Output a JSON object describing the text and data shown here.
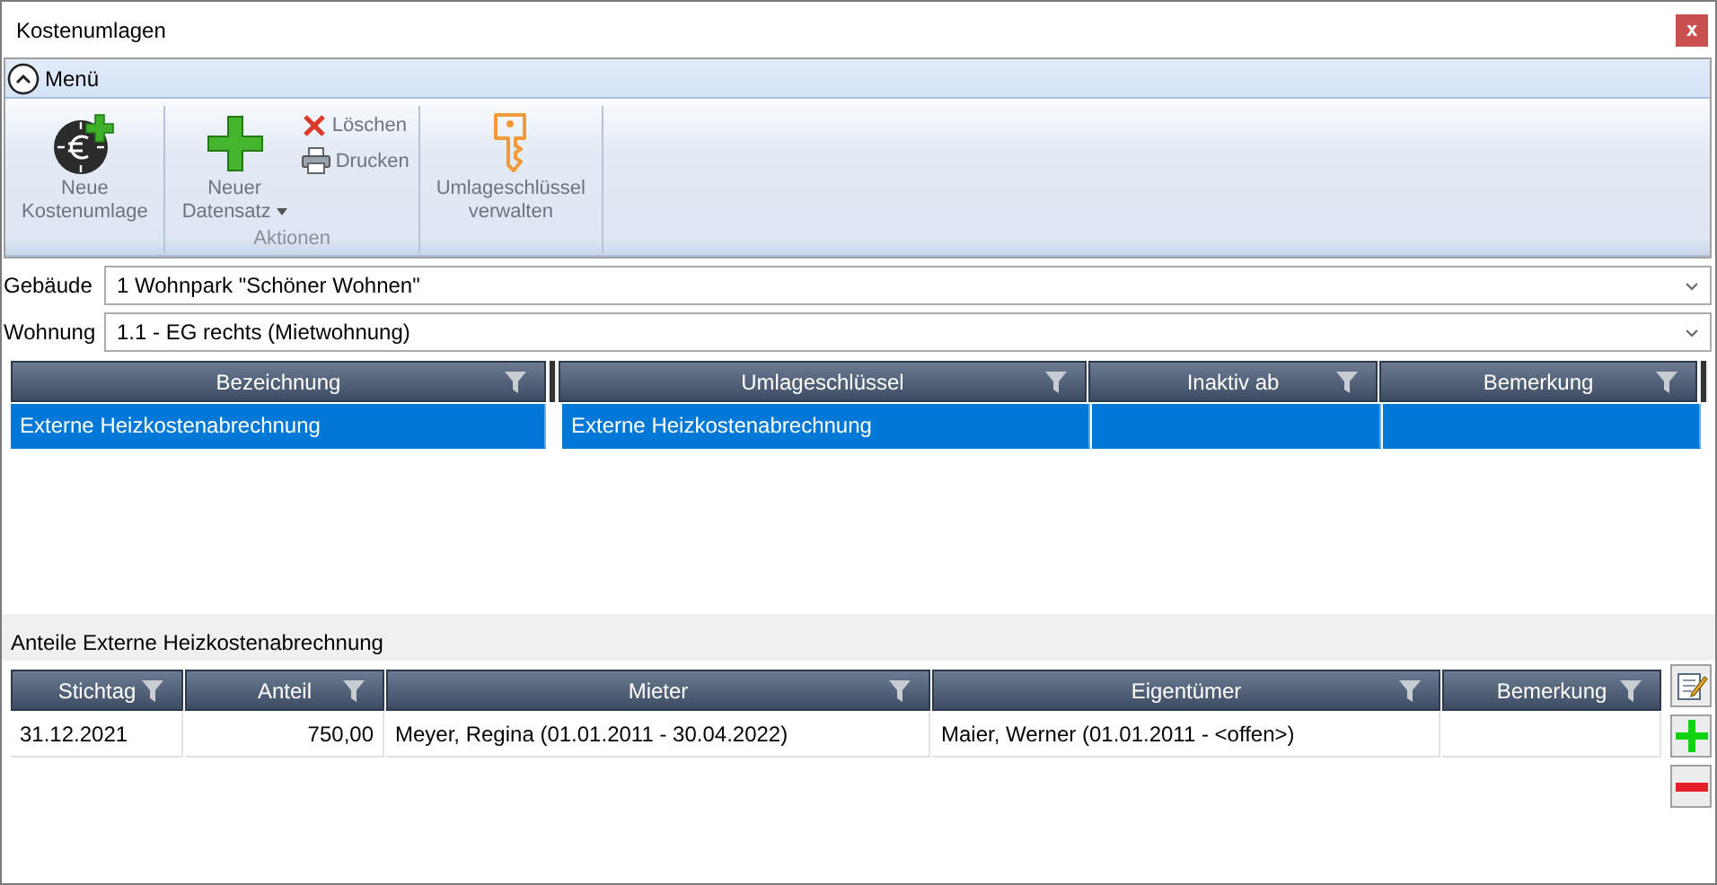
{
  "window": {
    "title": "Kostenumlagen",
    "close": "x"
  },
  "ribbon": {
    "toggle": "Menü",
    "expanded": true,
    "groups": [
      {
        "items": [
          {
            "kind": "large",
            "text": "Neue\nKostenumlage"
          }
        ]
      },
      {
        "label": "Aktionen",
        "items": [
          {
            "kind": "large",
            "text": "Neuer\nDatensatz",
            "dropdown": true
          },
          {
            "kind": "small",
            "text": "Löschen"
          },
          {
            "kind": "small",
            "text": "Drucken"
          }
        ]
      },
      {
        "items": [
          {
            "kind": "large",
            "text": "Umlageschlüssel\nverwalten"
          }
        ]
      }
    ]
  },
  "fields": [
    {
      "label": "Gebäude",
      "value": "1 Wohnpark \"Schöner Wohnen\""
    },
    {
      "label": "Wohnung",
      "value": "1.1 - EG rechts (Mietwohnung)"
    }
  ],
  "main_table": {
    "columns": [
      "Bezeichnung",
      "Umlageschlüssel",
      "Inaktiv ab",
      "Bemerkung"
    ],
    "rows": [
      {
        "selected": true,
        "cells": [
          "Externe Heizkostenabrechnung",
          "Externe Heizkostenabrechnung"
        ]
      }
    ]
  },
  "detail_title": "Anteile Externe Heizkostenabrechnung",
  "detail_table": {
    "columns": [
      "Stichtag",
      "Anteil",
      "Mieter",
      "Eigentümer",
      "Bemerkung"
    ],
    "rows": [
      {
        "selected": false,
        "cells": [
          "31.12.2021",
          "750,00",
          "Meyer, Regina (01.01.2011 - 30.04.2022)",
          "Maier, Werner (01.01.2011 - <offen>)"
        ]
      }
    ]
  },
  "side_buttons": [
    {
      "kind": "edit"
    },
    {
      "kind": "add"
    },
    {
      "kind": "remove"
    }
  ]
}
